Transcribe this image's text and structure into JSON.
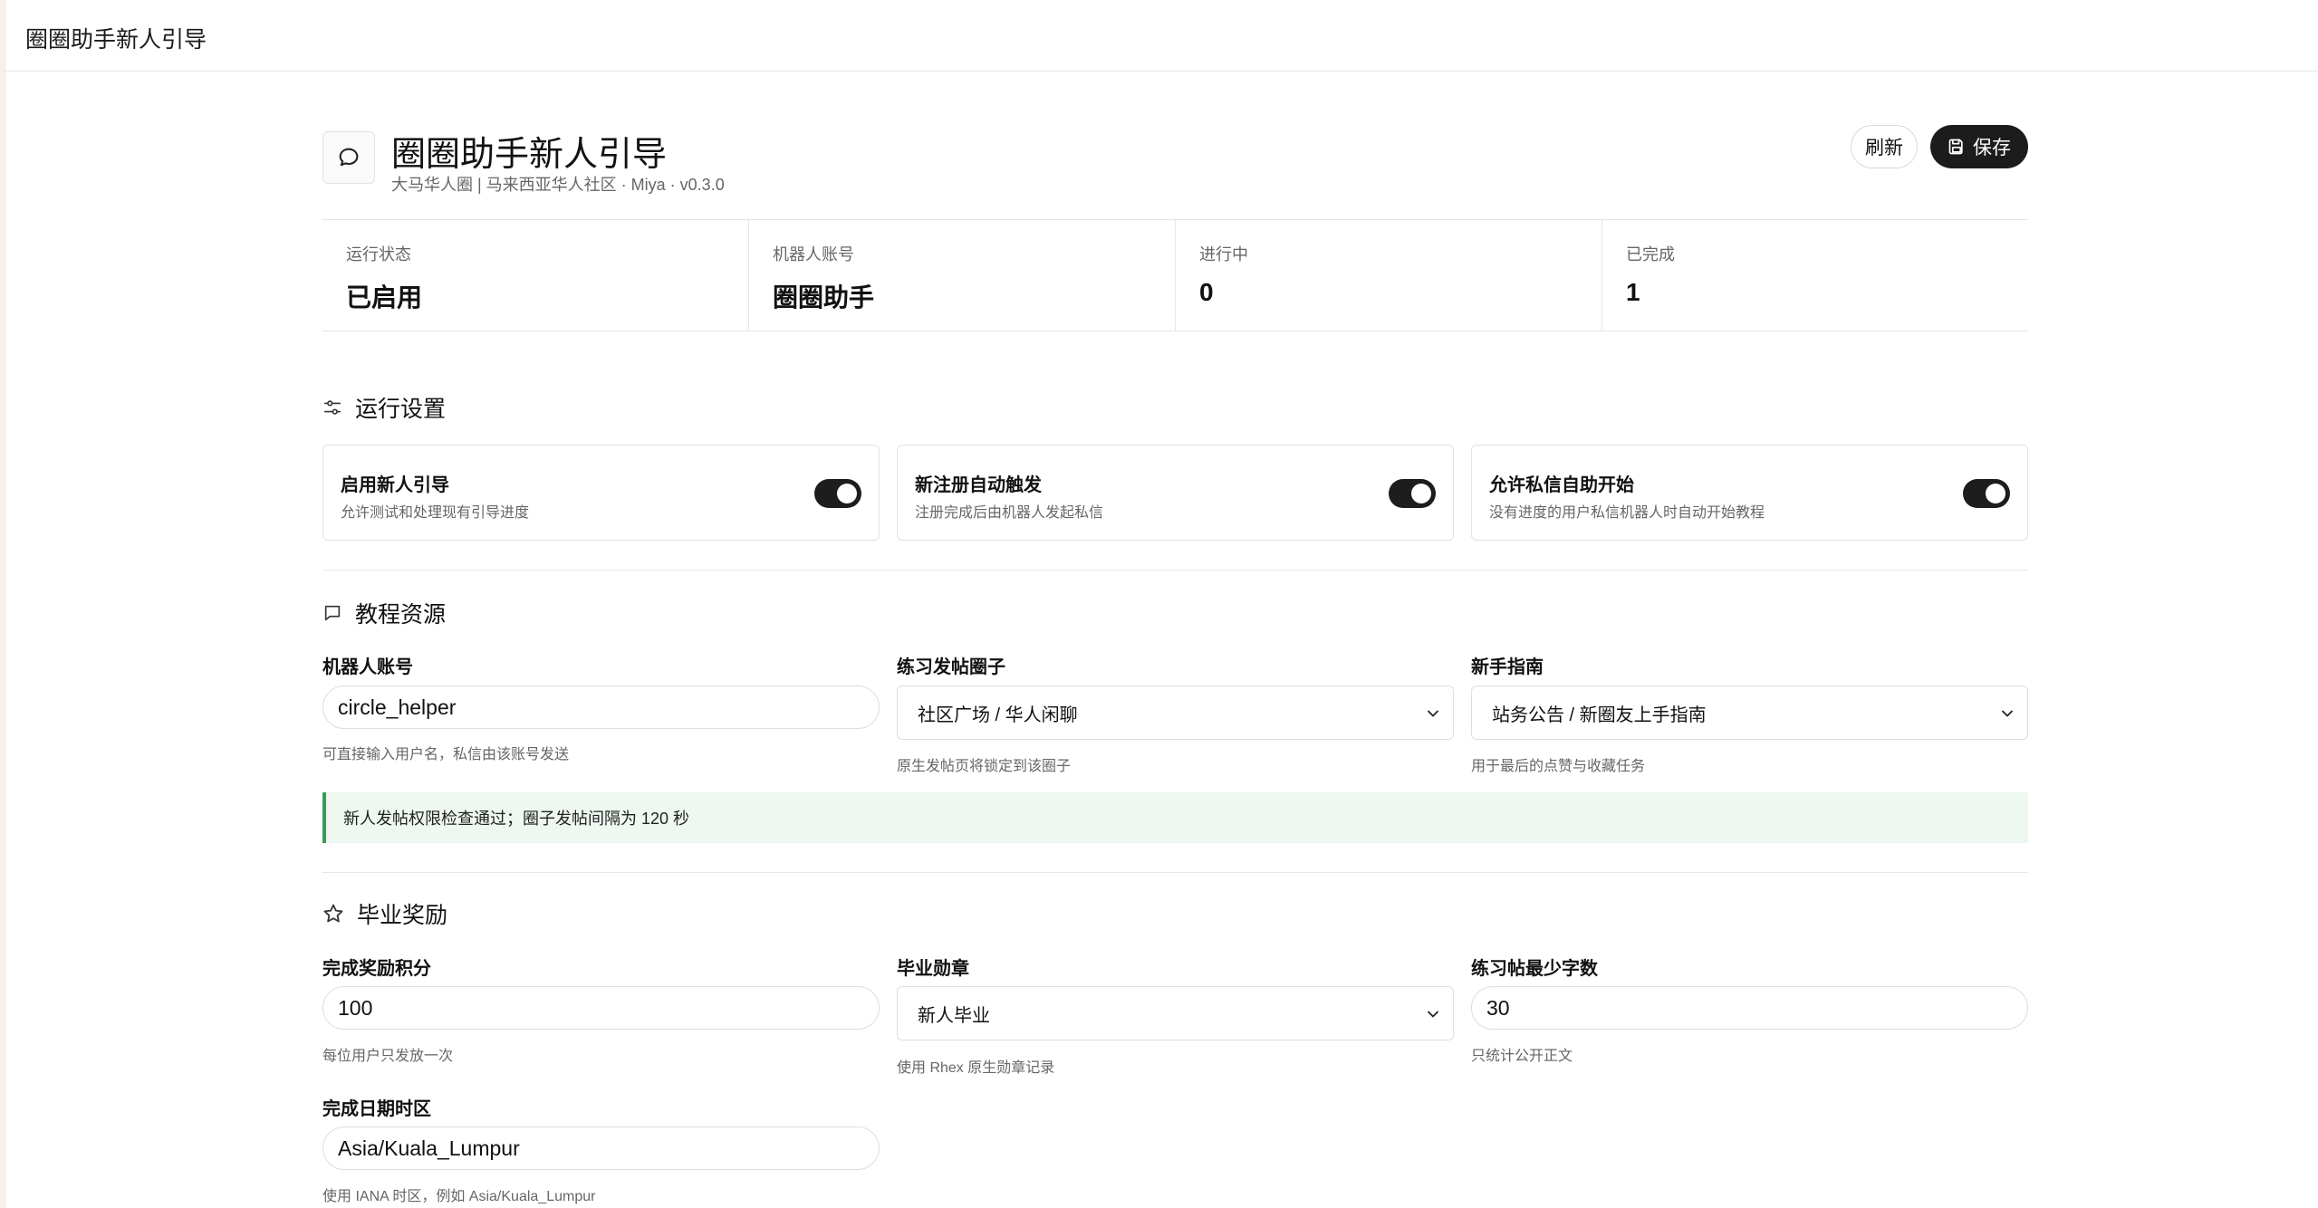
{
  "topbar": {
    "title": "圈圈助手新人引导"
  },
  "header": {
    "title": "圈圈助手新人引导",
    "subtitle": "大马华人圈 | 马来西亚华人社区 · Miya · v0.3.0",
    "refresh_label": "刷新",
    "save_label": "保存"
  },
  "stats": [
    {
      "label": "运行状态",
      "value": "已启用"
    },
    {
      "label": "机器人账号",
      "value": "圈圈助手"
    },
    {
      "label": "进行中",
      "value": "0"
    },
    {
      "label": "已完成",
      "value": "1"
    }
  ],
  "run_settings": {
    "title": "运行设置",
    "toggles": [
      {
        "title": "启用新人引导",
        "desc": "允许测试和处理现有引导进度",
        "on": true
      },
      {
        "title": "新注册自动触发",
        "desc": "注册完成后由机器人发起私信",
        "on": true
      },
      {
        "title": "允许私信自助开始",
        "desc": "没有进度的用户私信机器人时自动开始教程",
        "on": true
      }
    ]
  },
  "resources": {
    "title": "教程资源",
    "bot_account": {
      "label": "机器人账号",
      "value": "circle_helper",
      "hint": "可直接输入用户名，私信由该账号发送"
    },
    "practice_circle": {
      "label": "练习发帖圈子",
      "value": "社区广场 / 华人闲聊",
      "hint": "原生发帖页将锁定到该圈子"
    },
    "guide": {
      "label": "新手指南",
      "value": "站务公告 / 新圈友上手指南",
      "hint": "用于最后的点赞与收藏任务"
    },
    "notice": "新人发帖权限检查通过；圈子发帖间隔为 120 秒"
  },
  "rewards": {
    "title": "毕业奖励",
    "points": {
      "label": "完成奖励积分",
      "value": "100",
      "hint": "每位用户只发放一次"
    },
    "badge": {
      "label": "毕业勋章",
      "value": "新人毕业",
      "hint": "使用 Rhex 原生勋章记录"
    },
    "min_chars": {
      "label": "练习帖最少字数",
      "value": "30",
      "hint": "只统计公开正文"
    },
    "timezone": {
      "label": "完成日期时区",
      "value": "Asia/Kuala_Lumpur",
      "hint": "使用 IANA 时区，例如 Asia/Kuala_Lumpur"
    }
  },
  "colors": {
    "accent": "#1c1c1c",
    "notice_border": "#3b9a57",
    "notice_bg": "#eef7f0"
  },
  "icons": [
    "chat-bubble-icon",
    "save-icon",
    "sliders-icon",
    "message-square-icon",
    "star-icon",
    "chevron-down-icon"
  ]
}
